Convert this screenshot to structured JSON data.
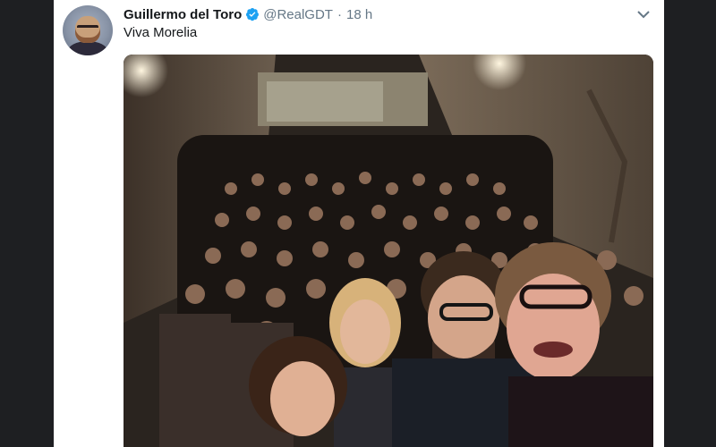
{
  "tweet": {
    "display_name": "Guillermo del Toro",
    "handle": "@RealGDT",
    "separator": "·",
    "time": "18 h",
    "text": "Viva Morelia",
    "verified": true,
    "avatar_icon": "profile-avatar",
    "menu_icon": "chevron-down-icon",
    "media_description_icon": "photo"
  },
  "colors": {
    "verified": "#1da1f2",
    "text": "#14171a",
    "secondary": "#657786",
    "frame": "#1e1f22"
  }
}
